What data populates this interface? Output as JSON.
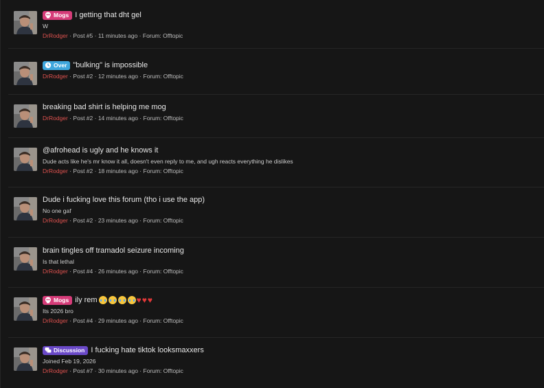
{
  "posts": [
    {
      "badge": {
        "label": "Mogs",
        "type": "mogs",
        "icon": "skull-icon"
      },
      "title": "I getting that dht gel",
      "snippet": "W",
      "author": "DrRodger",
      "post_no": "Post #5",
      "time": "11 minutes ago",
      "forum": "Forum: Offtopic"
    },
    {
      "badge": {
        "label": "Over",
        "type": "over",
        "icon": "clock-icon"
      },
      "title": "\"bulking\" is impossible",
      "snippet": "",
      "author": "DrRodger",
      "post_no": "Post #2",
      "time": "12 minutes ago",
      "forum": "Forum: Offtopic"
    },
    {
      "badge": null,
      "title": "breaking bad shirt is helping me mog",
      "snippet": "",
      "author": "DrRodger",
      "post_no": "Post #2",
      "time": "14 minutes ago",
      "forum": "Forum: Offtopic"
    },
    {
      "badge": null,
      "title": "@afrohead is ugly and he knows it",
      "snippet": "Dude acts like he's mr know it all, doesn't even reply to me, and ugh reacts everything he dislikes",
      "author": "DrRodger",
      "post_no": "Post #2",
      "time": "18 minutes ago",
      "forum": "Forum: Offtopic"
    },
    {
      "badge": null,
      "title": "Dude i fucking love this forum (tho i use the app)",
      "snippet": "No one gaf",
      "author": "DrRodger",
      "post_no": "Post #2",
      "time": "23 minutes ago",
      "forum": "Forum: Offtopic"
    },
    {
      "badge": null,
      "title": "brain tingles off tramadol seizure incoming",
      "snippet": "Is that lethal",
      "author": "DrRodger",
      "post_no": "Post #4",
      "time": "26 minutes ago",
      "forum": "Forum: Offtopic"
    },
    {
      "badge": {
        "label": "Mogs",
        "type": "mogs",
        "icon": "skull-icon"
      },
      "title": "ily rem",
      "title_emojis": [
        "loudly-crying-face",
        "loudly-crying-face",
        "loudly-crying-face",
        "loudly-crying-face",
        "red-heart",
        "red-heart",
        "red-heart"
      ],
      "snippet": "Its 2026 bro",
      "author": "DrRodger",
      "post_no": "Post #4",
      "time": "29 minutes ago",
      "forum": "Forum: Offtopic"
    },
    {
      "badge": {
        "label": "Discussion",
        "type": "discussion",
        "icon": "chat-bubbles-icon"
      },
      "title": "I fucking hate tiktok looksmaxxers",
      "snippet": "Joined Feb 19, 2026",
      "author": "DrRodger",
      "post_no": "Post #7",
      "time": "30 minutes ago",
      "forum": "Forum: Offtopic"
    }
  ],
  "separator": " · ",
  "colors": {
    "background": "#161616",
    "username": "#e0524f",
    "badge_mogs": "#d63c79",
    "badge_over": "#3fa7dd",
    "badge_discussion": "#6a49c8"
  }
}
